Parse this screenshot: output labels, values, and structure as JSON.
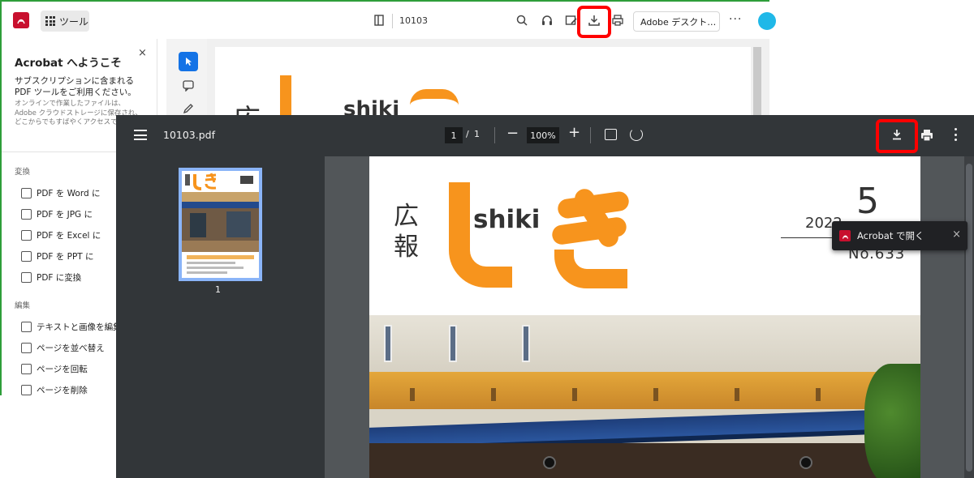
{
  "acrobat": {
    "tools_label": "ツール",
    "filename": "10103",
    "desktop_button": "Adobe デスクト…",
    "more": "···",
    "welcome": {
      "title": "Acrobat へようこそ",
      "close": "×",
      "description": "サブスクリプションに含まれる PDF ツールをご利用ください。",
      "subtext": "オンラインで作業したファイルは、Adobe クラウドストレージに保存され、どこからでもすばやくアクセスできます。"
    },
    "sections": {
      "convert": "変換",
      "edit": "編集"
    },
    "convert_items": [
      "PDF を Word に",
      "PDF を JPG に",
      "PDF を Excel に",
      "PDF を PPT に",
      "PDF に変換"
    ],
    "edit_items": [
      "テキストと画像を編集",
      "ページを並べ替え",
      "ページを回転",
      "ページを削除"
    ],
    "page_preview": {
      "kou": "広",
      "shiki": "shiki"
    }
  },
  "viewer": {
    "filename": "10103.pdf",
    "current_page": "1",
    "page_sep": "/",
    "total_pages": "1",
    "zoom_out": "−",
    "zoom": "100%",
    "zoom_in": "+",
    "thumbnail_page": "1"
  },
  "document": {
    "kanji": "広\n報",
    "shiki": "shiki",
    "year": "2022",
    "volume": "5",
    "issue": "No.633"
  },
  "toast": {
    "label": "Acrobat で開く",
    "close": "×"
  },
  "colors": {
    "acrobat_red": "#c8102e",
    "highlight": "#ff0000",
    "brand_orange": "#f7941d",
    "viewer_toolbar": "#323639",
    "selected_tool": "#1473e6"
  }
}
